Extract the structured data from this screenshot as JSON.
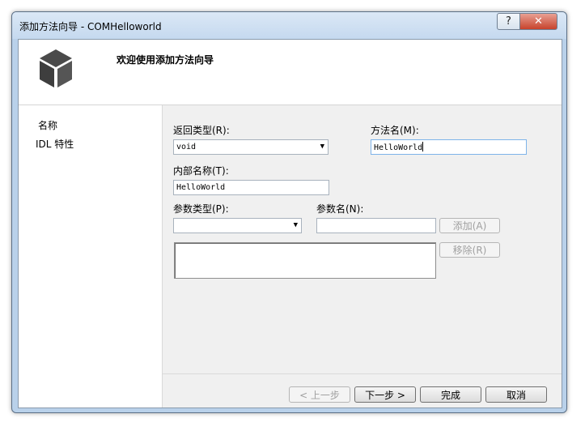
{
  "window": {
    "title": "添加方法向导 - COMHelloworld",
    "help_glyph": "?",
    "close_glyph": "✕"
  },
  "header": {
    "title": "欢迎使用添加方法向导"
  },
  "nav": {
    "items": [
      "名称",
      "IDL 特性"
    ]
  },
  "form": {
    "return_type_label": "返回类型(R):",
    "return_type_value": "void",
    "method_name_label": "方法名(M):",
    "method_name_value": "HelloWorld",
    "internal_name_label": "内部名称(T):",
    "internal_name_value": "HelloWorld",
    "param_type_label": "参数类型(P):",
    "param_type_value": "",
    "param_name_label": "参数名(N):",
    "param_name_value": "",
    "add_label": "添加(A)",
    "remove_label": "移除(R)"
  },
  "footer": {
    "prev_label": "< 上一步",
    "next_label": "下一步 >",
    "finish_label": "完成",
    "cancel_label": "取消"
  },
  "colors": {
    "titlebar": "#c5d9ef",
    "close": "#c7432c",
    "client": "#f0f0f0"
  },
  "icons": [
    "cube-logo-icon",
    "help-icon",
    "close-icon",
    "dropdown-arrow-icon"
  ]
}
